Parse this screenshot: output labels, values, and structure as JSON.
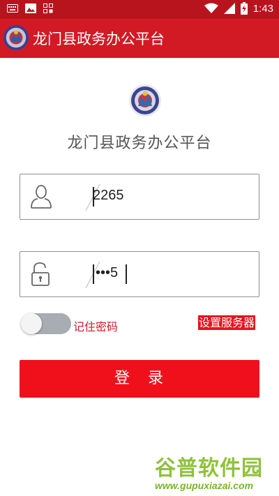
{
  "status_bar": {
    "time": "1:43",
    "icons": [
      "keyboard-icon",
      "image-icon",
      "grid-icon",
      "wifi-icon",
      "signal-icon",
      "battery-icon"
    ]
  },
  "app_bar": {
    "title": "龙门县政务办公平台",
    "logo": "county-emblem-icon"
  },
  "main": {
    "logo": "county-emblem-icon",
    "title": "龙门县政务办公平台",
    "username": {
      "value": "2265",
      "icon": "user-icon"
    },
    "password": {
      "masked_value": "•••5",
      "icon": "unlock-icon"
    },
    "remember": {
      "label": "记住密码",
      "on": false
    },
    "server_button": "设置服务器",
    "login_button": "登　录"
  },
  "watermark": {
    "title": "谷普软件园",
    "url": "www.gupuxiazai.com"
  },
  "colors": {
    "accent": "#d21a25",
    "status_bar": "#b8141e",
    "button": "#f0101b",
    "watermark": "#8fc23a"
  }
}
